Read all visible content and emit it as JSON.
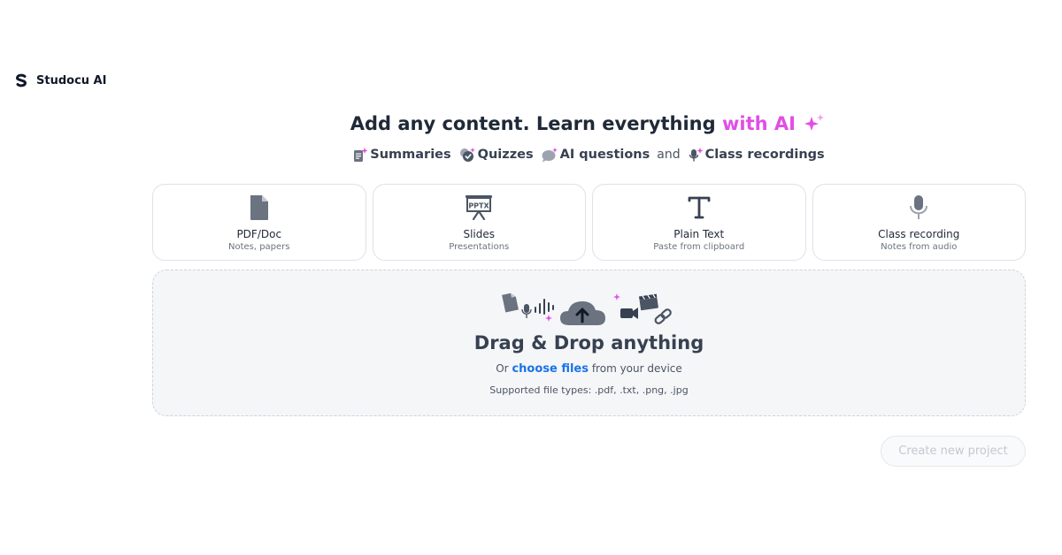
{
  "brand": {
    "name": "Studocu AI"
  },
  "headline": {
    "main": "Add any content. Learn everything ",
    "accent": "with AI"
  },
  "features": {
    "summaries": "Summaries",
    "quizzes": "Quizzes",
    "ai_questions": "AI questions",
    "and": "and",
    "class_recordings": "Class recordings"
  },
  "cards": [
    {
      "title": "PDF/Doc",
      "subtitle": "Notes, papers",
      "icon": "file-icon"
    },
    {
      "title": "Slides",
      "subtitle": "Presentations",
      "icon": "presentation-icon",
      "icon_label": "PPTX"
    },
    {
      "title": "Plain Text",
      "subtitle": "Paste from clipboard",
      "icon": "text-icon"
    },
    {
      "title": "Class recording",
      "subtitle": "Notes from audio",
      "icon": "microphone-icon"
    }
  ],
  "dropzone": {
    "title": "Drag & Drop anything",
    "or_text": "Or",
    "choose_link": "choose files",
    "from_text": "from your device",
    "supported": "Supported file types: .pdf, .txt, .png, .jpg"
  },
  "create_button": {
    "label": "Create new project",
    "enabled": false
  },
  "colors": {
    "accent": "#e14ee6",
    "link": "#1a73e8",
    "icon_gray": "#6b7280"
  }
}
